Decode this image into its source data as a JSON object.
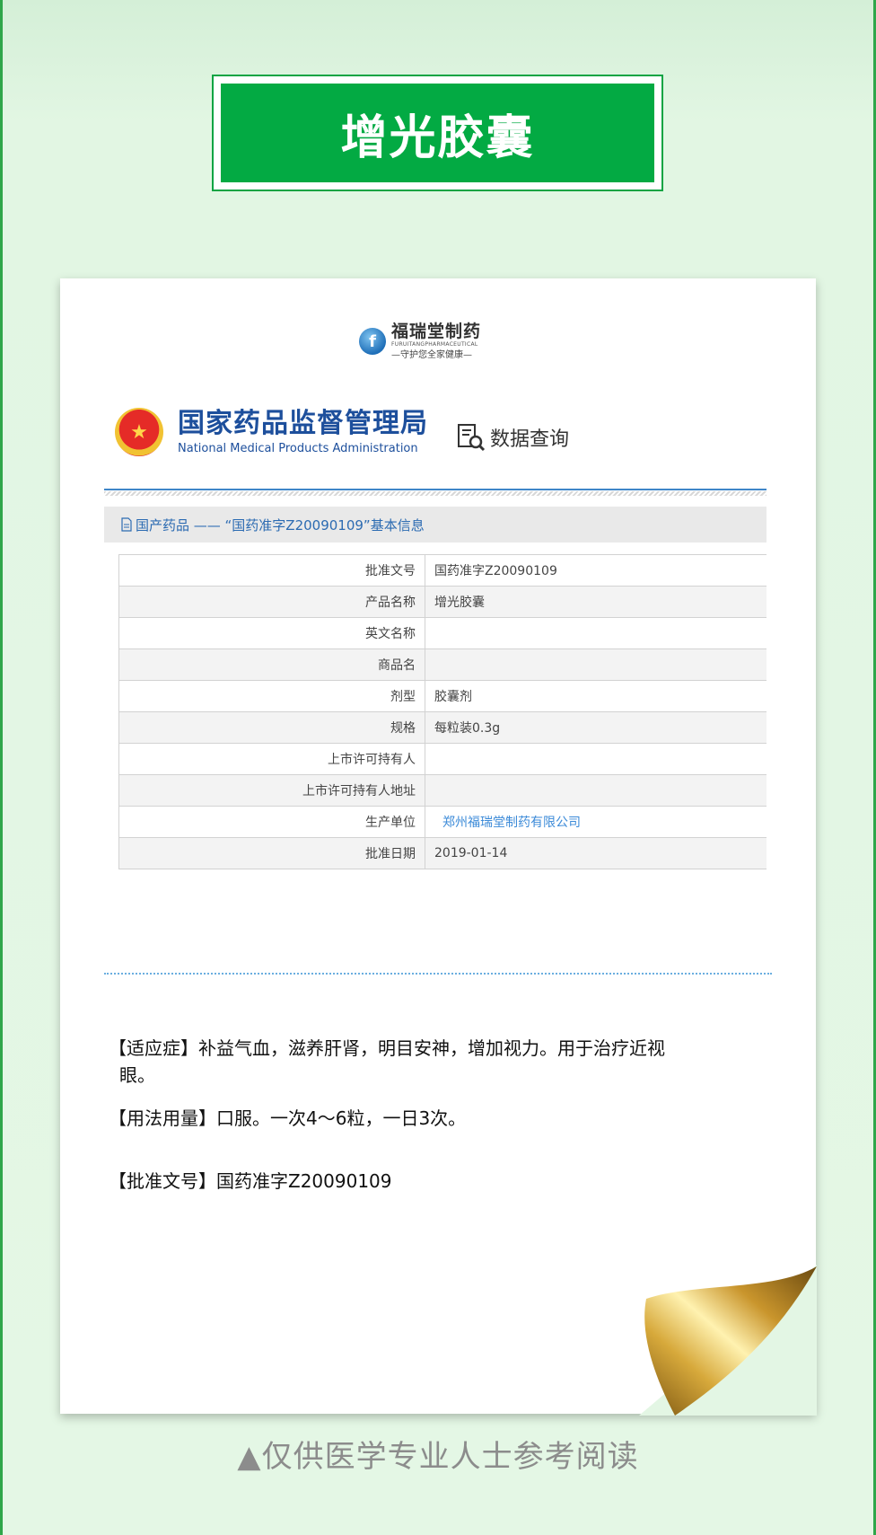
{
  "page_title": "增光胶囊",
  "brand": {
    "logo_letter": "f",
    "name_cn": "福瑞堂制药",
    "name_en": "FURUITANGPHARMACEUTICAL",
    "slogan": "—守护您全家健康—"
  },
  "agency": {
    "name_cn": "国家药品监督管理局",
    "name_en": "National Medical Products Administration",
    "query_label": "数据查询"
  },
  "section_header": "国产药品 —— “国药准字Z20090109”基本信息",
  "table": {
    "rows": [
      {
        "label": "批准文号",
        "value": "国药准字Z20090109"
      },
      {
        "label": "产品名称",
        "value": "增光胶囊"
      },
      {
        "label": "英文名称",
        "value": ""
      },
      {
        "label": "商品名",
        "value": ""
      },
      {
        "label": "剂型",
        "value": "胶囊剂"
      },
      {
        "label": "规格",
        "value": "每粒装0.3g"
      },
      {
        "label": "上市许可持有人",
        "value": ""
      },
      {
        "label": "上市许可持有人地址",
        "value": ""
      },
      {
        "label": "生产单位",
        "value": "郑州福瑞堂制药有限公司"
      },
      {
        "label": "批准日期",
        "value": "2019-01-14"
      }
    ]
  },
  "details": {
    "indication_line1": "【适应症】补益气血，滋养肝肾，明目安神，增加视力。用于治疗近视",
    "indication_line2": "眼。",
    "dosage": "【用法用量】口服。一次4～6粒，一日3次。",
    "approval": "【批准文号】国药准字Z20090109"
  },
  "disclaimer": "▲仅供医学专业人士参考阅读",
  "colors": {
    "accent_green": "#03aa43",
    "agency_blue": "#1d4f9c",
    "link_blue": "#3b8ad8"
  }
}
